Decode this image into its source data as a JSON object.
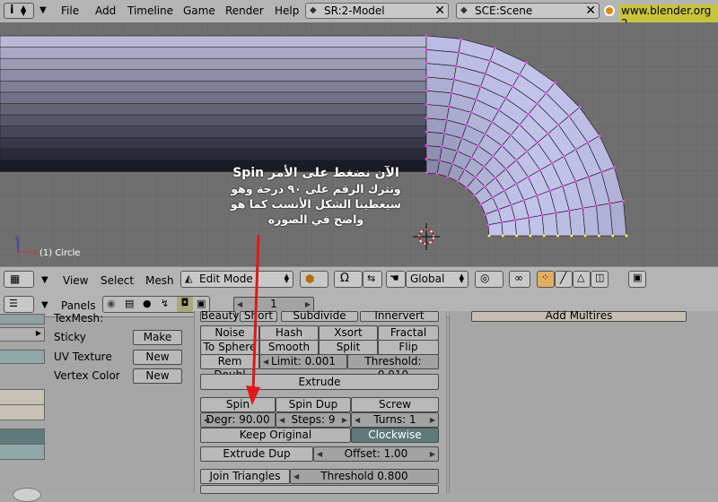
{
  "menubar": {
    "items": [
      "File",
      "Add",
      "Timeline",
      "Game",
      "Render",
      "Help"
    ],
    "screen_field": "SR:2-Model",
    "scene_field": "SCE:Scene",
    "website": "www.blender.org 2"
  },
  "viewport": {
    "object_label": "(1) Circle",
    "annotation": {
      "line1": "الآن نضغط على الأمر Spin",
      "line2": "ونترك الرقم على ٩٠ درجة وهو",
      "line3": "سيعطينا الشكل الأنسب كما هو",
      "line4": "واضح في الصوره"
    }
  },
  "view_header": {
    "view": "View",
    "select": "Select",
    "mesh": "Mesh",
    "mode": "Edit Mode",
    "orientation": "Global"
  },
  "buttons_header": {
    "panels": "Panels",
    "frame": "1"
  },
  "mesh_panel": {
    "texmesh": "TexMesh:",
    "sticky": "Sticky",
    "sticky_btn": "Make",
    "uv_texture": "UV Texture",
    "uv_btn": "New",
    "vertex_color": "Vertex Color",
    "vc_btn": "New"
  },
  "tools": {
    "row0": [
      "Beauty",
      "Short",
      "Subdivide",
      "Innervert"
    ],
    "row1": [
      "Noise",
      "Hash",
      "Xsort",
      "Fractal"
    ],
    "row2": [
      "To Sphere",
      "Smooth",
      "Split",
      "Flip Normal"
    ],
    "rem_doubles": "Rem Doubl",
    "limit": "Limit: 0.001",
    "threshold": "Threshold: 0.010",
    "extrude": "Extrude",
    "spin": "Spin",
    "spin_dup": "Spin Dup",
    "screw": "Screw",
    "degr": "Degr: 90.00",
    "steps": "Steps: 9",
    "turns": "Turns: 1",
    "keep_original": "Keep Original",
    "clockwise": "Clockwise",
    "extrude_dup": "Extrude Dup",
    "offset": "Offset: 1.00",
    "join_triangles": "Join Triangles",
    "join_threshold": "Threshold 0.800"
  },
  "multires": {
    "add_multires": "Add Multires"
  }
}
